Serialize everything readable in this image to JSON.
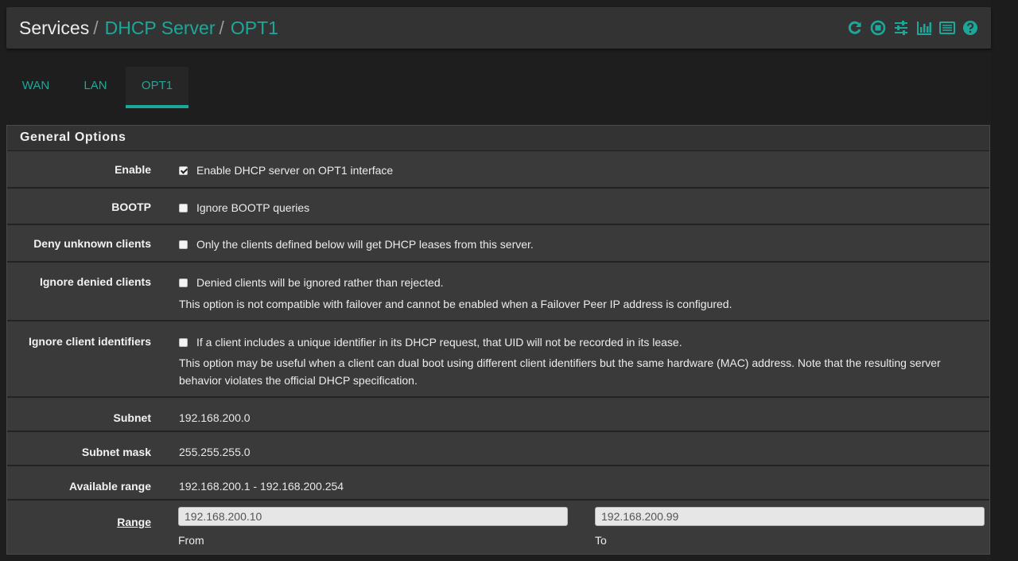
{
  "breadcrumb": {
    "root": "Services",
    "separator": "/",
    "items": [
      "DHCP Server",
      "OPT1"
    ]
  },
  "header_icons": [
    "reload-icon",
    "stop-service-icon",
    "settings-sliders-icon",
    "graph-icon",
    "logs-icon",
    "help-icon"
  ],
  "tabs": [
    {
      "label": "WAN",
      "active": false
    },
    {
      "label": "LAN",
      "active": false
    },
    {
      "label": "OPT1",
      "active": true
    }
  ],
  "section": {
    "title": "General Options"
  },
  "fields": {
    "enable": {
      "label": "Enable",
      "checked": true,
      "text": "Enable DHCP server on OPT1 interface"
    },
    "bootp": {
      "label": "BOOTP",
      "checked": false,
      "text": "Ignore BOOTP queries"
    },
    "deny_unknown": {
      "label": "Deny unknown clients",
      "checked": false,
      "text": "Only the clients defined below will get DHCP leases from this server."
    },
    "ignore_denied": {
      "label": "Ignore denied clients",
      "checked": false,
      "text": "Denied clients will be ignored rather than rejected.",
      "help": "This option is not compatible with failover and cannot be enabled when a Failover Peer IP address is configured."
    },
    "ignore_client_ids": {
      "label": "Ignore client identifiers",
      "checked": false,
      "text": "If a client includes a unique identifier in its DHCP request, that UID will not be recorded in its lease.",
      "help": "This option may be useful when a client can dual boot using different client identifiers but the same hardware (MAC) address. Note that the resulting server behavior violates the official DHCP specification."
    },
    "subnet": {
      "label": "Subnet",
      "value": "192.168.200.0"
    },
    "subnet_mask": {
      "label": "Subnet mask",
      "value": "255.255.255.0"
    },
    "available_range": {
      "label": "Available range",
      "value": "192.168.200.1 - 192.168.200.254"
    },
    "range": {
      "label": "Range",
      "from_value": "192.168.200.10",
      "from_label": "From",
      "to_value": "192.168.200.99",
      "to_label": "To"
    }
  },
  "colors": {
    "accent": "#1ba89a",
    "background": "#1e1e1e",
    "panel": "#3a3a3a"
  }
}
